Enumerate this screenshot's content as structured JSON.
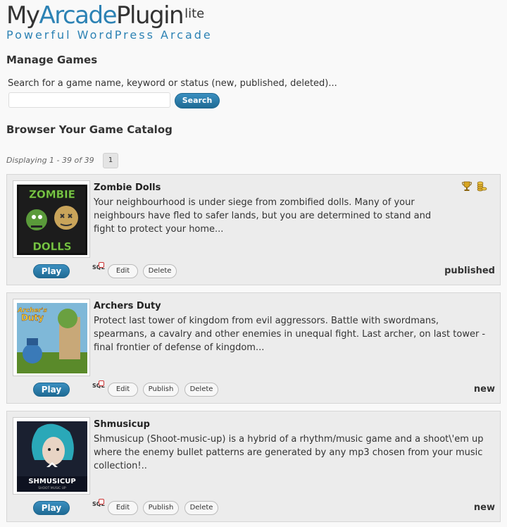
{
  "logo": {
    "main_prefix": "My",
    "main_brand": "Arcade",
    "main_suffix": "Plugin",
    "lite": "lite",
    "tagline": "Powerful WordPress Arcade"
  },
  "manage": {
    "heading": "Manage Games",
    "search_label": "Search for a game name, keyword or status (new, published, deleted)...",
    "search_value": "",
    "search_button": "Search"
  },
  "catalog": {
    "heading": "Browser Your Game Catalog",
    "displaying": "Displaying 1 - 39 of 39",
    "page": "1"
  },
  "games": [
    {
      "title": "Zombie Dolls",
      "description": "Your neighbourhood is under siege from zombified dolls. Many of your neighbours have fled to safer lands, but you are determined to stand and fight to protect your home...",
      "play": "Play",
      "sql": "SQL",
      "actions": [
        "Edit",
        "Delete"
      ],
      "status": "published",
      "thumb_text": [
        "ZOMBIE",
        "DOLLS"
      ]
    },
    {
      "title": "Archers Duty",
      "description": "Protect last tower of kingdom from evil aggressors. Battle with swordmans, spearmans, a cavalry and other enemies in unequal fight. Last archer, on last tower - final frontier of defense of kingdom...",
      "play": "Play",
      "sql": "SQL",
      "actions": [
        "Edit",
        "Publish",
        "Delete"
      ],
      "status": "new",
      "thumb_text": [
        "Archer's",
        "Duty"
      ]
    },
    {
      "title": "Shmusicup",
      "description": "Shmusicup (Shoot-music-up) is a hybrid of a rhythm/music game and a shoot\\'em up where the enemy bullet patterns are generated by any mp3 chosen from your music collection!..",
      "play": "Play",
      "sql": "SQL",
      "actions": [
        "Edit",
        "Publish",
        "Delete"
      ],
      "status": "new",
      "thumb_text": [
        "SHMUSICUP",
        "SHOOT MUSIC UP"
      ]
    }
  ]
}
